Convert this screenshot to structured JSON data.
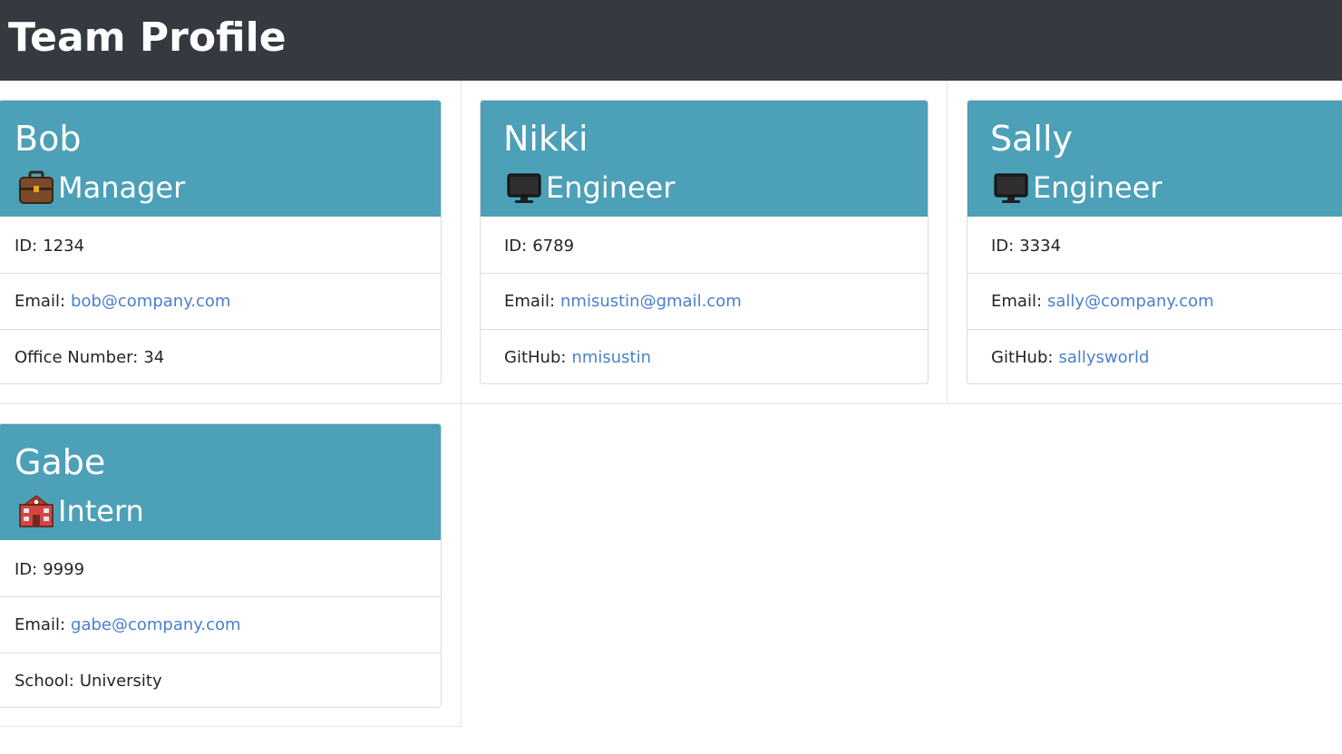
{
  "header": {
    "title": "Team Profile"
  },
  "team": [
    {
      "name": "Bob",
      "role": "Manager",
      "role_icon": "briefcase-icon",
      "id_label": "ID:",
      "id_value": "1234",
      "email_label": "Email:",
      "email": "bob@company.com",
      "extra_label": "Office Number:",
      "extra_value": "34"
    },
    {
      "name": "Nikki",
      "role": "Engineer",
      "role_icon": "computer-icon",
      "id_label": "ID:",
      "id_value": "6789",
      "email_label": "Email:",
      "email": "nmisustin@gmail.com",
      "extra_label": "GitHub:",
      "extra_value": "nmisustin"
    },
    {
      "name": "Sally",
      "role": "Engineer",
      "role_icon": "computer-icon",
      "id_label": "ID:",
      "id_value": "3334",
      "email_label": "Email:",
      "email": "sally@company.com",
      "extra_label": "GitHub:",
      "extra_value": "sallysworld"
    },
    {
      "name": "Gabe",
      "role": "Intern",
      "role_icon": "school-icon",
      "id_label": "ID:",
      "id_value": "9999",
      "email_label": "Email:",
      "email": "gabe@company.com",
      "extra_label": "School:",
      "extra_value": "University"
    }
  ],
  "colors": {
    "navbar_bg": "#343a40",
    "card_header_bg": "#4ca0b7",
    "link": "#4a7fcf",
    "text": "#212529"
  }
}
